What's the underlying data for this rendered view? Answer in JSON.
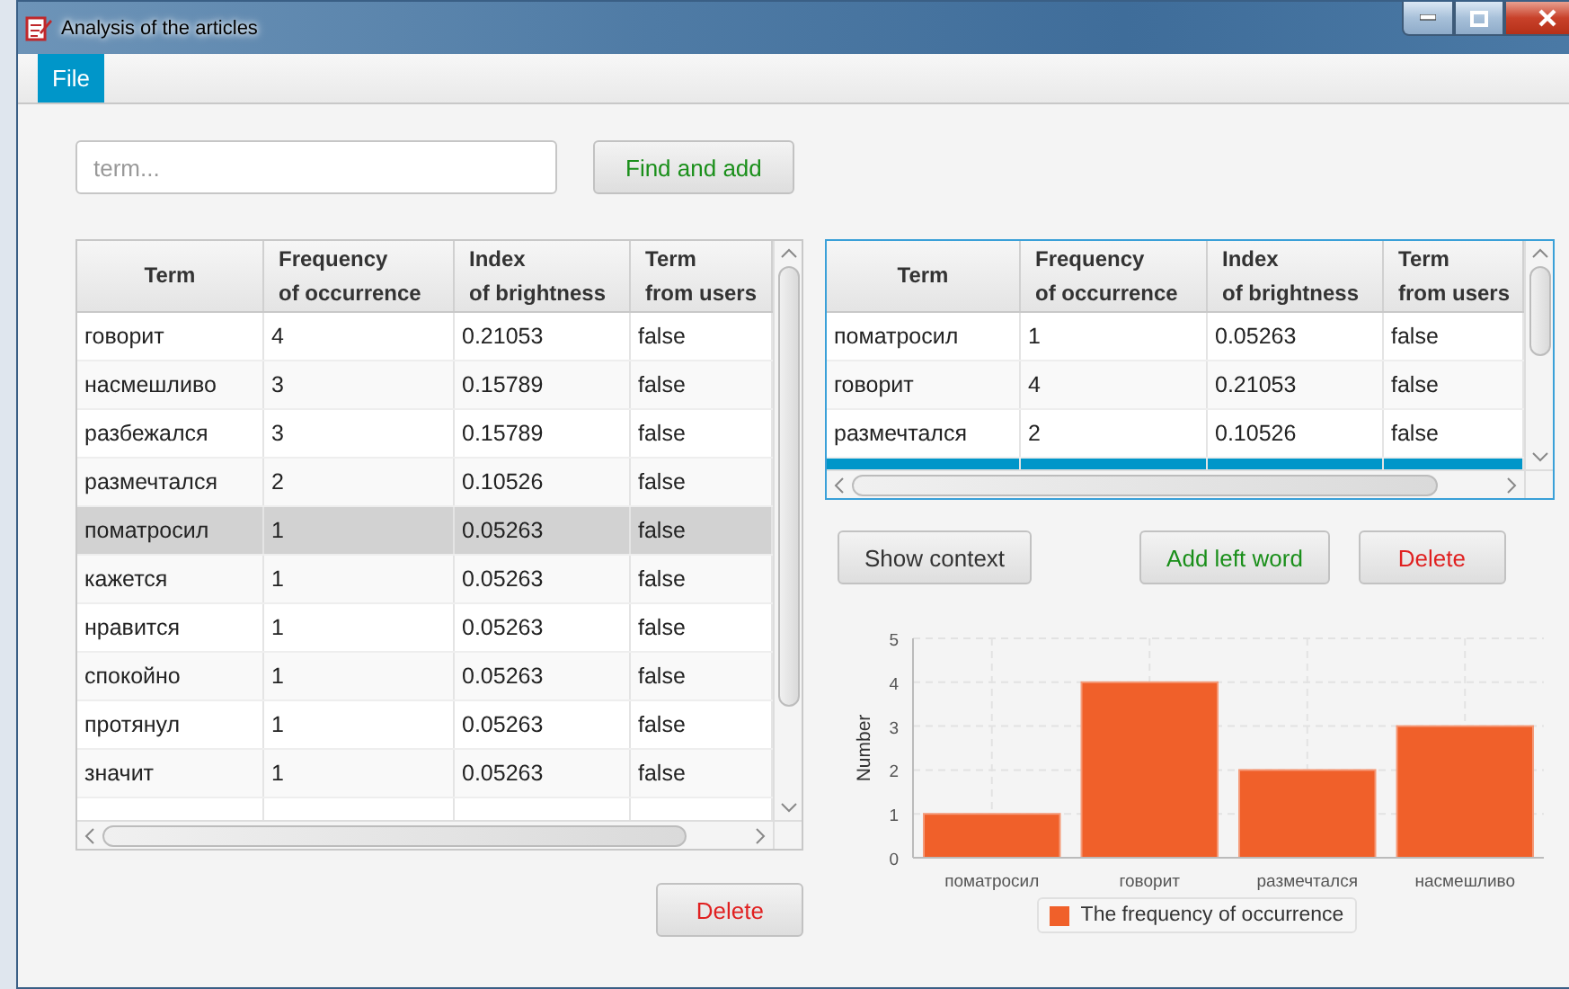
{
  "window": {
    "title": "Analysis of the articles"
  },
  "menu": [
    {
      "label": "File",
      "selected": true
    }
  ],
  "search": {
    "placeholder": "term..."
  },
  "find_button": "Find and add",
  "left_table": {
    "columns": [
      "Term",
      "Frequency\nof occurrence",
      "Index\nof brightness",
      "Term\nfrom users"
    ],
    "rows": [
      {
        "cells": [
          "говорит",
          "4",
          "0.21053",
          "false"
        ],
        "selected": false
      },
      {
        "cells": [
          "насмешливо",
          "3",
          "0.15789",
          "false"
        ],
        "selected": false
      },
      {
        "cells": [
          "разбежался",
          "3",
          "0.15789",
          "false"
        ],
        "selected": false
      },
      {
        "cells": [
          "размечтался",
          "2",
          "0.10526",
          "false"
        ],
        "selected": false
      },
      {
        "cells": [
          "поматросил",
          "1",
          "0.05263",
          "false"
        ],
        "selected": true
      },
      {
        "cells": [
          "кажется",
          "1",
          "0.05263",
          "false"
        ],
        "selected": false
      },
      {
        "cells": [
          "нравится",
          "1",
          "0.05263",
          "false"
        ],
        "selected": false
      },
      {
        "cells": [
          "спокойно",
          "1",
          "0.05263",
          "false"
        ],
        "selected": false
      },
      {
        "cells": [
          "протянул",
          "1",
          "0.05263",
          "false"
        ],
        "selected": false
      },
      {
        "cells": [
          "значит",
          "1",
          "0.05263",
          "false"
        ],
        "selected": false
      },
      {
        "cells": [],
        "selected": false
      }
    ]
  },
  "left_delete": "Delete",
  "right_table": {
    "columns": [
      "Term",
      "Frequency\nof occurrence",
      "Index\nof brightness",
      "Term\nfrom users"
    ],
    "rows": [
      {
        "cells": [
          "поматросил",
          "1",
          "0.05263",
          "false"
        ],
        "selected": false
      },
      {
        "cells": [
          "говорит",
          "4",
          "0.21053",
          "false"
        ],
        "selected": false
      },
      {
        "cells": [
          "размечтался",
          "2",
          "0.10526",
          "false"
        ],
        "selected": false
      },
      {
        "cells": [],
        "selected": true
      }
    ]
  },
  "actions": [
    {
      "label": "Show context",
      "kind": "neutral"
    },
    {
      "label": "Add left word",
      "kind": "add"
    },
    {
      "label": "Delete",
      "kind": "delete"
    }
  ],
  "chart": {
    "chart_data": {
      "type": "bar",
      "ylabel": "Number",
      "categories": [
        "поматросил",
        "говорит",
        "размечтался",
        "насмешливо"
      ],
      "series": [
        {
          "name": "The frequency of occurrence",
          "color": "#f0602a",
          "values": [
            1,
            4,
            2,
            3
          ]
        }
      ],
      "grid": true,
      "ylim": [
        0,
        5
      ],
      "yticks": [
        0,
        1,
        2,
        3,
        4,
        5
      ]
    }
  }
}
